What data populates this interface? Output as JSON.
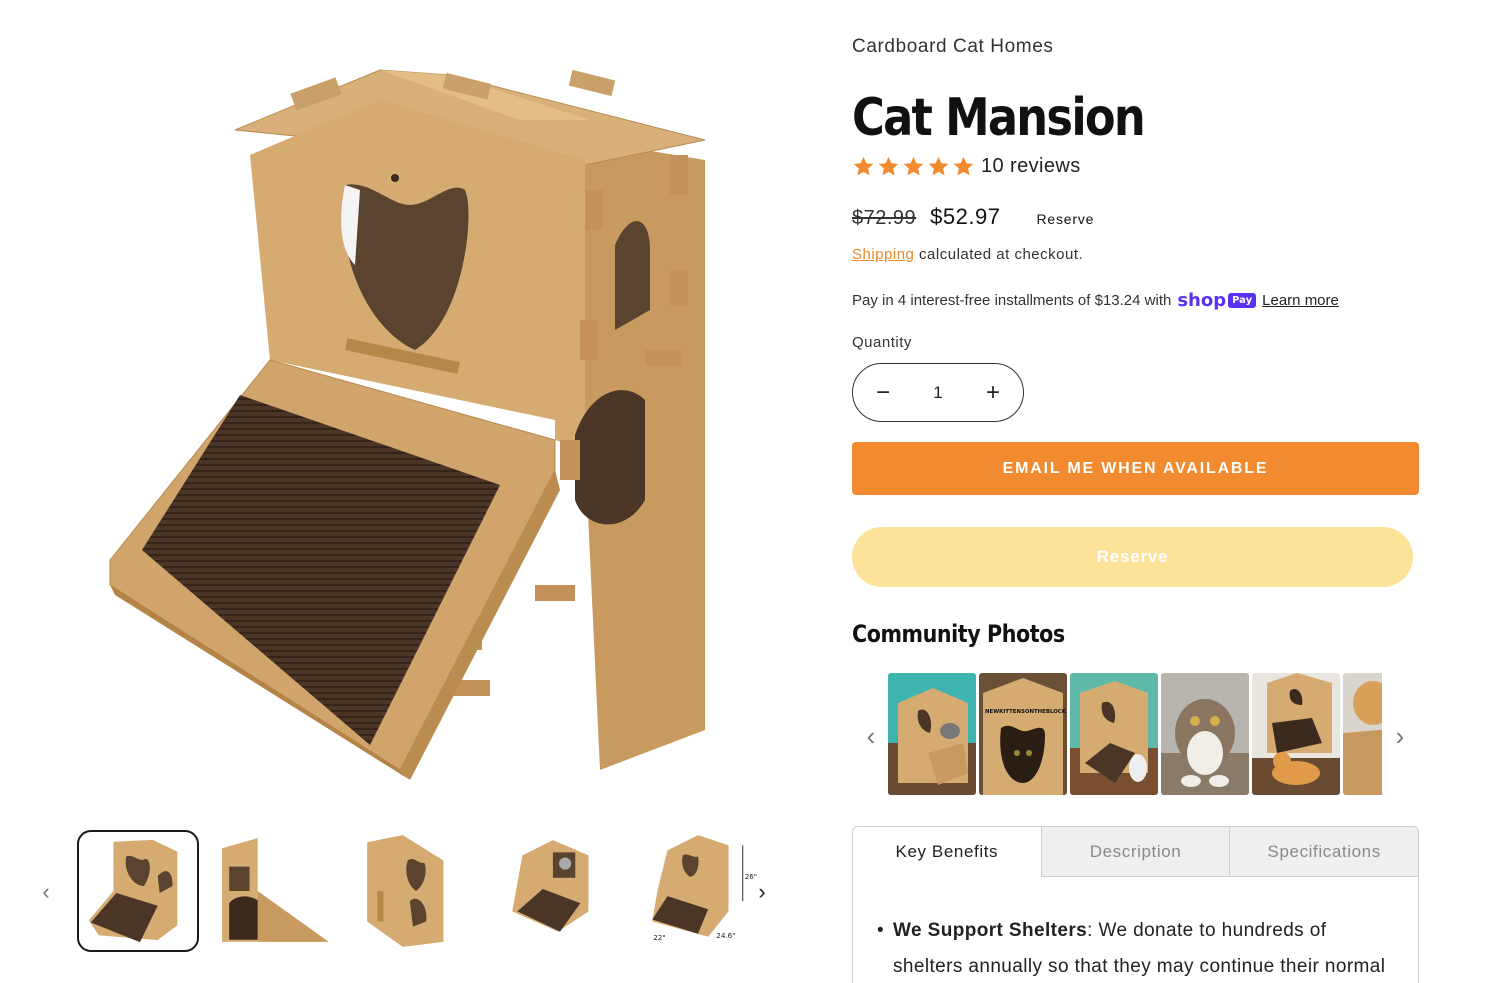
{
  "gallery": {
    "main_alt": "Cat Mansion cardboard cat house",
    "thumb_prev": "‹",
    "thumb_next": "›",
    "thumb_labels": {
      "height": "26\"",
      "width": "22\"",
      "depth": "24.6\""
    }
  },
  "product": {
    "brand": "Cardboard Cat Homes",
    "title": "Cat Mansion",
    "rating": 5,
    "reviews": "10 reviews",
    "compare_price": "$72.99",
    "price": "$52.97",
    "price_badge": "Reserve",
    "shipping_link": "Shipping",
    "shipping_text": " calculated at checkout.",
    "installments_text": "Pay in 4 interest-free installments of $13.24 with",
    "shop_logo": "shop",
    "shop_pay": "Pay",
    "learn_more": "Learn more",
    "quantity_label": "Quantity",
    "quantity_value": "1",
    "qty_minus": "−",
    "qty_plus": "+",
    "email_button": "EMAIL ME WHEN AVAILABLE",
    "reserve_button": "Reserve"
  },
  "community": {
    "title": "Community Photos",
    "prev": "‹",
    "next": "›",
    "photo2_text": "NEWKITTENSONTHEBLOCK"
  },
  "tabs": {
    "items": [
      "Key Benefits",
      "Description",
      "Specifications"
    ],
    "active": 0,
    "content": {
      "bullet_title": "We Support Shelters",
      "bullet_text": ": We donate to hundreds of shelters annually so that they may continue their normal"
    }
  },
  "colors": {
    "accent": "#f28a30",
    "reserve": "#fde39a",
    "star": "#f28a30",
    "shop_pay": "#5a31f4"
  }
}
